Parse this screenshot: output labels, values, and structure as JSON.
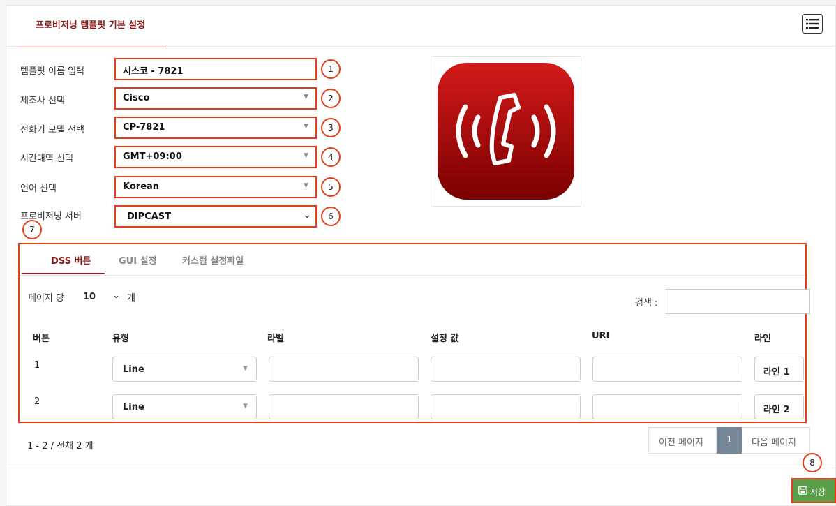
{
  "header": {
    "tab_title": "프로비저닝 템플릿 기본 설정"
  },
  "form": {
    "template_name": {
      "label": "템플릿 이름 입력",
      "value": "시스코 - 7821",
      "marker": "1"
    },
    "manufacturer": {
      "label": "제조사 선택",
      "value": "Cisco",
      "marker": "2"
    },
    "model": {
      "label": "전화기 모델 선택",
      "value": "CP-7821",
      "marker": "3"
    },
    "timezone": {
      "label": "시간대역 선택",
      "value": "GMT+09:00",
      "marker": "4"
    },
    "language": {
      "label": "언어 선택",
      "value": "Korean",
      "marker": "5"
    },
    "server": {
      "label": "프로비저닝 서버",
      "value": "DIPCAST",
      "marker": "6"
    }
  },
  "dss_marker": "7",
  "tabs": [
    {
      "label": "DSS 버튼",
      "active": true
    },
    {
      "label": "GUI 설정",
      "active": false
    },
    {
      "label": "커스텀 설정파일",
      "active": false
    }
  ],
  "table_controls": {
    "per_page_label": "페이지 당",
    "per_page_value": "10",
    "per_page_unit": "개",
    "search_label": "검색 :",
    "search_value": ""
  },
  "columns": [
    "버튼",
    "유형",
    "라벨",
    "설정 값",
    "URI",
    "라인"
  ],
  "rows": [
    {
      "button": "1",
      "type": "Line",
      "label": "",
      "value": "",
      "uri": "",
      "line": "라인 1"
    },
    {
      "button": "2",
      "type": "Line",
      "label": "",
      "value": "",
      "uri": "",
      "line": "라인 2"
    }
  ],
  "pagination": {
    "summary": "1 - 2 / 전체 2 개",
    "prev": "이전 페이지",
    "current": "1",
    "next": "다음 페이지"
  },
  "save": {
    "label": "저장",
    "marker": "8"
  },
  "colors": {
    "accent": "#8b1a1a",
    "annotation": "#e2401c",
    "save": "#5a9e4a",
    "pager_active": "#778899"
  },
  "icons": {
    "list": "list-icon",
    "phone_logo": "phone-app-logo",
    "save": "floppy-disk-icon"
  }
}
